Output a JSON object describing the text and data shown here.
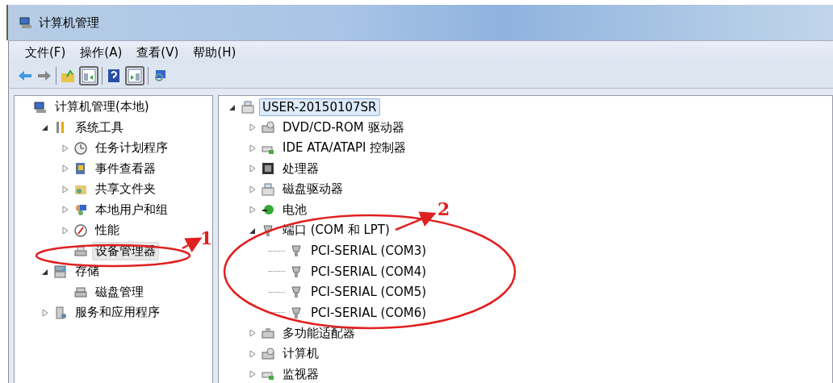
{
  "window": {
    "title": "计算机管理"
  },
  "menu": [
    {
      "label": "文件(F)"
    },
    {
      "label": "操作(A)"
    },
    {
      "label": "查看(V)"
    },
    {
      "label": "帮助(H)"
    }
  ],
  "console_tree": [
    {
      "label": "计算机管理(本地)",
      "selected": false,
      "children": [
        {
          "label": "系统工具",
          "selected": false,
          "expanded": true,
          "children": [
            {
              "label": "任务计划程序",
              "selected": false,
              "expanded": false
            },
            {
              "label": "事件查看器",
              "selected": false,
              "expanded": false
            },
            {
              "label": "共享文件夹",
              "selected": false,
              "expanded": false
            },
            {
              "label": "本地用户和组",
              "selected": false,
              "expanded": false
            },
            {
              "label": "性能",
              "selected": false,
              "expanded": false
            },
            {
              "label": "设备管理器",
              "selected": true
            }
          ]
        },
        {
          "label": "存储",
          "selected": false,
          "expanded": true,
          "children": [
            {
              "label": "磁盘管理",
              "selected": false
            }
          ]
        },
        {
          "label": "服务和应用程序",
          "selected": false,
          "expanded": false
        }
      ]
    }
  ],
  "device_tree": [
    {
      "label": "USER-20150107SR",
      "selected": true,
      "expanded": true,
      "children": [
        {
          "label": "DVD/CD-ROM 驱动器",
          "selected": false,
          "expanded": false
        },
        {
          "label": "IDE ATA/ATAPI 控制器",
          "selected": false,
          "expanded": false
        },
        {
          "label": "处理器",
          "selected": false,
          "expanded": false
        },
        {
          "label": "磁盘驱动器",
          "selected": false,
          "expanded": false
        },
        {
          "label": "电池",
          "selected": false,
          "expanded": false
        },
        {
          "label": "端口 (COM 和 LPT)",
          "selected": false,
          "expanded": true,
          "children": [
            {
              "label": "PCI-SERIAL (COM3)",
              "selected": false
            },
            {
              "label": "PCI-SERIAL (COM4)",
              "selected": false
            },
            {
              "label": "PCI-SERIAL (COM5)",
              "selected": false
            },
            {
              "label": "PCI-SERIAL (COM6)",
              "selected": false
            }
          ]
        },
        {
          "label": "多功能适配器",
          "selected": false,
          "expanded": false
        },
        {
          "label": "计算机",
          "selected": false,
          "expanded": false
        },
        {
          "label": "监视器",
          "selected": false,
          "expanded": false
        }
      ]
    }
  ],
  "annotations": [
    {
      "label": "1"
    },
    {
      "label": "2"
    }
  ]
}
